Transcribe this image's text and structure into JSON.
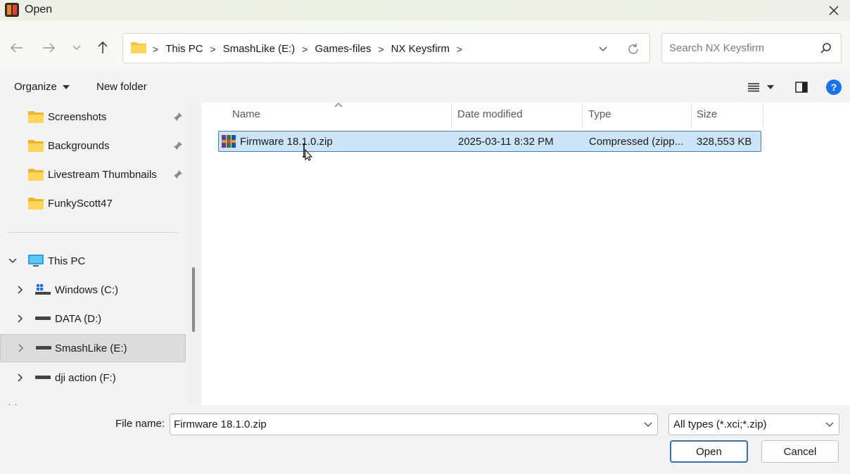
{
  "window": {
    "title": "Open"
  },
  "address": {
    "crumbs": [
      "This PC",
      "SmashLike (E:)",
      "Games-files",
      "NX Keysfirm"
    ],
    "separator": ">"
  },
  "search": {
    "placeholder": "Search NX Keysfirm"
  },
  "toolbar": {
    "organize_label": "Organize",
    "new_folder_label": "New folder"
  },
  "sidebar": {
    "quick_access": [
      {
        "label": "Screenshots",
        "pinned": true
      },
      {
        "label": "Backgrounds",
        "pinned": true
      },
      {
        "label": "Livestream Thumbnails",
        "pinned": true
      },
      {
        "label": "FunkyScott47",
        "pinned": false
      }
    ],
    "this_pc_label": "This PC",
    "drives": [
      {
        "label": "Windows (C:)",
        "icon": "windows-drive-icon"
      },
      {
        "label": "DATA (D:)",
        "icon": "drive-icon"
      },
      {
        "label": "SmashLike (E:)",
        "icon": "drive-icon",
        "selected": true
      },
      {
        "label": "dji action (F:)",
        "icon": "drive-icon"
      }
    ]
  },
  "columns": {
    "name": "Name",
    "date": "Date modified",
    "type": "Type",
    "size": "Size"
  },
  "files": [
    {
      "name": "Firmware 18.1.0.zip",
      "date": "2025-03-11 8:32 PM",
      "type": "Compressed (zipp...",
      "size": "328,553 KB",
      "selected": true
    }
  ],
  "footer": {
    "file_name_label": "File name:",
    "file_name_value": "Firmware 18.1.0.zip",
    "file_type_value": "All types (*.xci;*.zip)",
    "open_label": "Open",
    "cancel_label": "Cancel"
  },
  "colors": {
    "selection": "#cce4f7",
    "selection_border": "#4b7dac",
    "help": "#1a73e8",
    "folder": "#f5c542"
  }
}
